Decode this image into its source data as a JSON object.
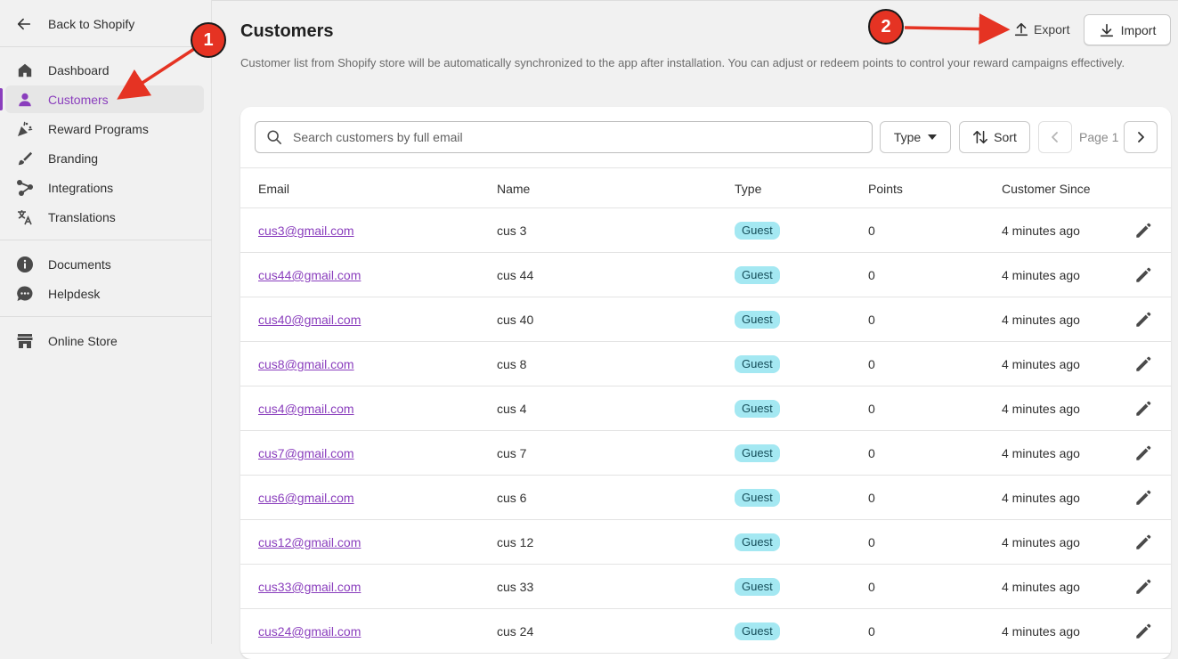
{
  "sidebar": {
    "back_label": "Back to Shopify",
    "nav": [
      {
        "label": "Dashboard",
        "icon": "home-icon"
      },
      {
        "label": "Customers",
        "icon": "person-icon",
        "active": true
      },
      {
        "label": "Reward Programs",
        "icon": "confetti-icon"
      },
      {
        "label": "Branding",
        "icon": "paintbrush-icon"
      },
      {
        "label": "Integrations",
        "icon": "integrations-icon"
      },
      {
        "label": "Translations",
        "icon": "translate-icon"
      }
    ],
    "nav2": [
      {
        "label": "Documents",
        "icon": "info-icon"
      },
      {
        "label": "Helpdesk",
        "icon": "chat-icon"
      }
    ],
    "nav3": [
      {
        "label": "Online Store",
        "icon": "store-icon"
      }
    ]
  },
  "page": {
    "title": "Customers",
    "description": "Customer list from Shopify store will be automatically synchronized to the app after installation. You can adjust or redeem points to control your reward campaigns effectively.",
    "export_label": "Export",
    "import_label": "Import"
  },
  "toolbar": {
    "search_placeholder": "Search customers by full email",
    "type_label": "Type",
    "sort_label": "Sort",
    "page_label": "Page 1"
  },
  "table": {
    "headers": {
      "email": "Email",
      "name": "Name",
      "type": "Type",
      "points": "Points",
      "since": "Customer Since"
    },
    "rows": [
      {
        "email": "cus3@gmail.com",
        "name": "cus 3",
        "type": "Guest",
        "points": "0",
        "since": "4 minutes ago"
      },
      {
        "email": "cus44@gmail.com",
        "name": "cus 44",
        "type": "Guest",
        "points": "0",
        "since": "4 minutes ago"
      },
      {
        "email": "cus40@gmail.com",
        "name": "cus 40",
        "type": "Guest",
        "points": "0",
        "since": "4 minutes ago"
      },
      {
        "email": "cus8@gmail.com",
        "name": "cus 8",
        "type": "Guest",
        "points": "0",
        "since": "4 minutes ago"
      },
      {
        "email": "cus4@gmail.com",
        "name": "cus 4",
        "type": "Guest",
        "points": "0",
        "since": "4 minutes ago"
      },
      {
        "email": "cus7@gmail.com",
        "name": "cus 7",
        "type": "Guest",
        "points": "0",
        "since": "4 minutes ago"
      },
      {
        "email": "cus6@gmail.com",
        "name": "cus 6",
        "type": "Guest",
        "points": "0",
        "since": "4 minutes ago"
      },
      {
        "email": "cus12@gmail.com",
        "name": "cus 12",
        "type": "Guest",
        "points": "0",
        "since": "4 minutes ago"
      },
      {
        "email": "cus33@gmail.com",
        "name": "cus 33",
        "type": "Guest",
        "points": "0",
        "since": "4 minutes ago"
      },
      {
        "email": "cus24@gmail.com",
        "name": "cus 24",
        "type": "Guest",
        "points": "0",
        "since": "4 minutes ago"
      }
    ]
  },
  "annotations": {
    "marker1": "1",
    "marker2": "2"
  },
  "colors": {
    "accent": "#8a3ebd",
    "badge_bg": "#a4e8f2",
    "marker": "#e53323"
  }
}
